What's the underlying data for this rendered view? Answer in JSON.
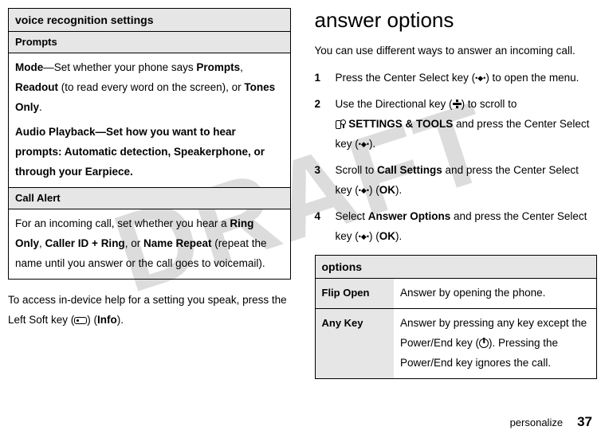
{
  "watermark": "DRAFT",
  "left": {
    "table_header": "voice recognition settings",
    "row1_subhead": "Prompts",
    "row1_body_pre": "—Set whether your phone says ",
    "row1_mode": "Mode",
    "row1_prompts": "Prompts",
    "row1_readout": "Readout",
    "row1_mid": " (to read every word on the screen), or ",
    "row1_tones": "Tones Only",
    "row1_audio": "Audio Playback—Set how you want to hear prompts: Automatic detection, Speakerphone, or through your Earpiece.",
    "row2_subhead": "Call Alert",
    "row2_pre": "For an incoming call, set whether you hear a ",
    "row2_ringonly": "Ring Only",
    "row2_cid": "Caller ID + Ring",
    "row2_or": ", or ",
    "row2_name": "Name Repeat",
    "row2_post": " (repeat the name until you answer or the call goes to voicemail).",
    "para_pre": "To access in-device help for a setting you speak, press the Left Soft key (",
    "para_post": ") (",
    "para_info": "Info",
    "para_end": ")."
  },
  "right": {
    "heading": "answer options",
    "lead": "You can use different ways to answer an incoming call.",
    "s1_a": "Press the Center Select key (",
    "s1_b": ") to open the menu.",
    "s2_a": "Use the Directional key (",
    "s2_b": ") to scroll to ",
    "s2_label": "SETTINGS & TOOLS",
    "s2_c": " and press the Center Select key (",
    "s2_d": ").",
    "s3_a": "Scroll to ",
    "s3_label": "Call Settings",
    "s3_b": " and press the Center Select key (",
    "s3_c": ") (",
    "s3_ok": "OK",
    "s3_d": ").",
    "s4_a": "Select ",
    "s4_label": "Answer Options",
    "s4_b": " and press the Center Select key (",
    "s4_c": ") (",
    "s4_ok": "OK",
    "s4_d": ").",
    "opt_header": "options",
    "opt1_label": "Flip Open",
    "opt1_desc": "Answer by opening the phone.",
    "opt2_label": "Any Key",
    "opt2_a": "Answer by pressing any key except the Power/End key (",
    "opt2_b": "). Pressing the Power/End key ignores the call."
  },
  "footer": {
    "section": "personalize",
    "page": "37"
  }
}
